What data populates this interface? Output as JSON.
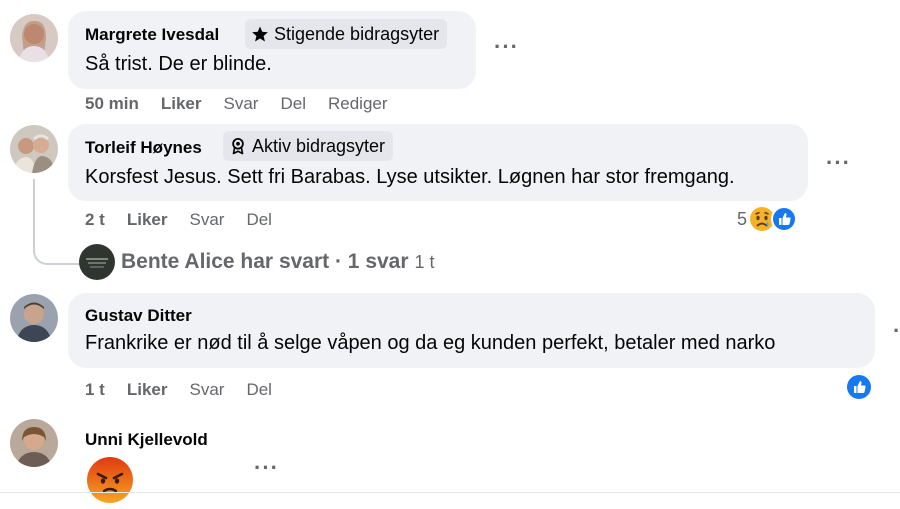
{
  "comments": [
    {
      "author": "Margrete Ivesdal",
      "badge": "Stigende bidragsyter",
      "badge_icon": "star-icon",
      "text": "Så trist. De er blinde.",
      "time": "50 min",
      "like": "Liker",
      "reply": "Svar",
      "share": "Del",
      "edit": "Rediger"
    },
    {
      "author": "Torleif Høynes",
      "badge": "Aktiv bidragsyter",
      "badge_icon": "award-icon",
      "text": "Korsfest Jesus. Sett fri Barabas. Lyse utsikter. Løgnen har stor fremgang.",
      "time": "2 t",
      "like": "Liker",
      "reply": "Svar",
      "share": "Del",
      "reaction_count": "5",
      "reply_summary": "Bente Alice har svart · 1 svar",
      "reply_time": "1 t"
    },
    {
      "author": "Gustav Ditter",
      "text": "Frankrike er nød til å selge våpen og da eg kunden perfekt, betaler med narko",
      "time": "1 t",
      "like": "Liker",
      "reply": "Svar",
      "share": "Del"
    },
    {
      "author": "Unni Kjellevold"
    }
  ],
  "colors": {
    "bubble": "#f0f2f5",
    "secondary_text": "#65676b",
    "like_blue": "#1877f2",
    "sad_yellow": "#f7b125",
    "angry_red": "#e9710f"
  }
}
